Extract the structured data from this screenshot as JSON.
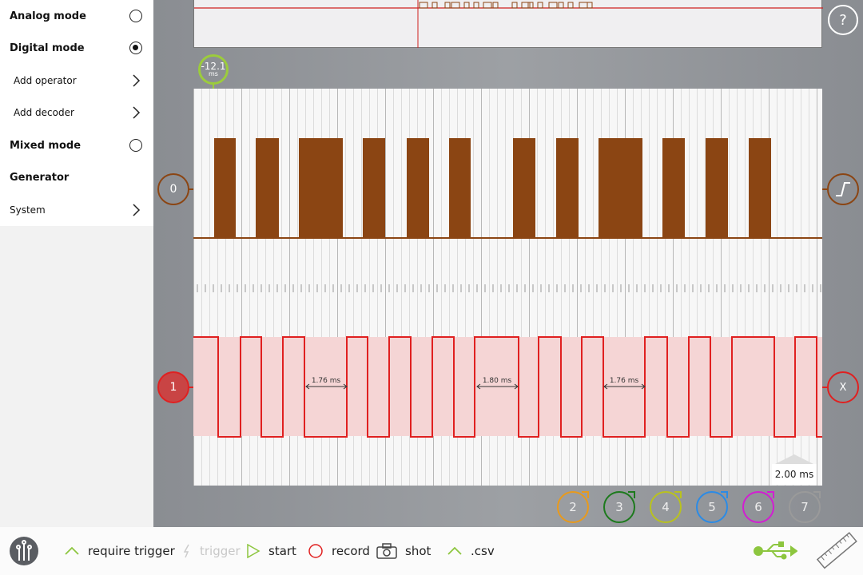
{
  "menu": {
    "items": [
      {
        "label": "Analog mode",
        "control": "radio",
        "selected": false
      },
      {
        "label": "Digital mode",
        "control": "radio",
        "selected": true
      },
      {
        "label": "Add operator",
        "control": "chevron"
      },
      {
        "label": "Add decoder",
        "control": "chevron"
      },
      {
        "label": "Mixed mode",
        "control": "radio",
        "selected": false
      },
      {
        "label": "Generator",
        "control": "none"
      },
      {
        "label": "System",
        "control": "chevron"
      }
    ]
  },
  "help": {
    "label": "?"
  },
  "cursor": {
    "value": "-12.1",
    "unit": "ms"
  },
  "channels": {
    "ch0": {
      "label": "0",
      "color": "#8b4513"
    },
    "ch1": {
      "label": "1",
      "color": "#e02020"
    },
    "right_trigger_icon": "trigger-edge-icon",
    "right_x": "X"
  },
  "measurements": [
    {
      "label": "1.76 ms"
    },
    {
      "label": "1.80 ms"
    },
    {
      "label": "1.76 ms"
    }
  ],
  "timebase": {
    "label": "2.00 ms"
  },
  "extra_channels": [
    {
      "label": "2",
      "color": "#e89a1c"
    },
    {
      "label": "3",
      "color": "#1d7a1d"
    },
    {
      "label": "4",
      "color": "#b9c21e"
    },
    {
      "label": "5",
      "color": "#2b8be6"
    },
    {
      "label": "6",
      "color": "#d21ed2"
    },
    {
      "label": "7",
      "color": "#9a9a9a"
    }
  ],
  "toolbar": {
    "require_trigger": "require trigger",
    "trigger": "trigger",
    "start": "start",
    "record": "record",
    "shot": "shot",
    "csv": ".csv"
  },
  "colors": {
    "accent": "#8dc63f",
    "ch0": "#8b4513",
    "ch1": "#e02020"
  }
}
